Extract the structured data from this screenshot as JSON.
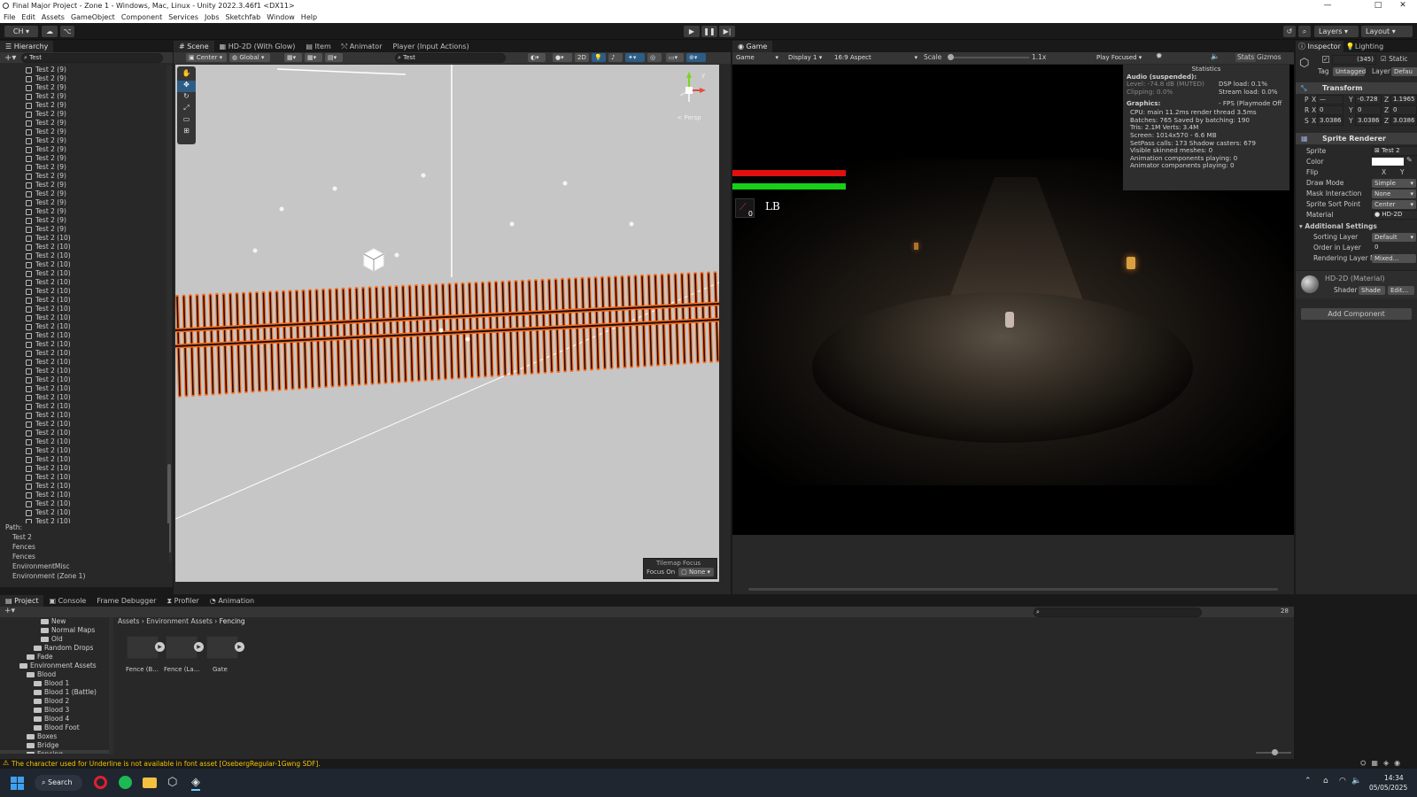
{
  "window": {
    "title": "Final Major Project - Zone 1 - Windows, Mac, Linux - Unity 2022.3.46f1 <DX11>"
  },
  "menu": [
    "File",
    "Edit",
    "Assets",
    "GameObject",
    "Component",
    "Services",
    "Jobs",
    "Sketchfab",
    "Window",
    "Help"
  ],
  "toolbar": {
    "account": "CH ▾",
    "layers": "Layers",
    "layout": "Layout"
  },
  "hierarchy": {
    "tab": "Hierarchy",
    "search": "Test",
    "items_a": "Test 2 (9)",
    "items_b": "Test 2 (10)",
    "count_a": 19,
    "count_b": 34,
    "path_label": "Path:",
    "path": [
      "Test 2",
      "Fences",
      "Fences",
      "EnvironmentMisc",
      "Environment (Zone 1)"
    ]
  },
  "scene": {
    "tabs": [
      "Scene",
      "HD-2D (With Glow)",
      "Item",
      "Animator",
      "Player (Input Actions)"
    ],
    "pivot": "Center",
    "space": "Global",
    "search": "Test",
    "mode2d": "2D",
    "gizmo_label": "< Persp",
    "tilemap_title": "Tilemap Focus",
    "focus_on": "Focus On",
    "focus_value": "None"
  },
  "game": {
    "tab": "Game",
    "view": "Game",
    "display": "Display 1",
    "aspect": "16:9 Aspect",
    "scale_label": "Scale",
    "scale_value": "1.1x",
    "play_focused": "Play Focused",
    "stats_btn": "Stats",
    "gizmos_btn": "Gizmos",
    "hud_button": "LB",
    "hud_item_count": "0",
    "health_fill": 1.0,
    "stamina_fill": 1.0
  },
  "statistics": {
    "title": "Statistics",
    "audio_title": "Audio (suspended):",
    "level": "Level: -74.8 dB (MUTED)",
    "clipping": "Clipping: 0.0%",
    "dsp": "DSP load: 0.1%",
    "stream": "Stream load: 0.0%",
    "graphics_title": "Graphics:",
    "fps": "- FPS (Playmode Off",
    "cpu": "CPU: main 11.2ms  render thread 3.5ms",
    "batches": "Batches: 765    Saved by batching: 190",
    "tris": "Tris: 2.1M          Verts: 3.4M",
    "screen": "Screen: 1014x570 - 6.6 MB",
    "setpass": "SetPass calls: 173       Shadow casters: 679",
    "skinned": "Visible skinned meshes: 0",
    "anim": "Animation components playing: 0",
    "animator": "Animator components playing: 0"
  },
  "inspector": {
    "tabs": [
      "Inspector",
      "Lighting"
    ],
    "object_name": "(345)",
    "static": "Static",
    "tag_label": "Tag",
    "tag": "Untagged",
    "layer_label": "Layer",
    "layer": "Defau",
    "transform": "Transform",
    "p_label": "P",
    "px": "X",
    "py": "Y",
    "pz": "Z",
    "pos_x": "—",
    "pos_y": "-0.728",
    "pos_z": "1.1965",
    "r_label": "R",
    "rot_x": "0",
    "rot_y": "0",
    "rot_z": "0",
    "s_label": "S",
    "scl_x": "3.0386",
    "scl_y": "3.0386",
    "scl_z": "3.0386",
    "sprite_renderer": "Sprite Renderer",
    "sprite_label": "Sprite",
    "sprite": "Test 2",
    "color_label": "Color",
    "flip_label": "Flip",
    "flip_x": "X",
    "flip_y": "Y",
    "draw_mode_label": "Draw Mode",
    "draw_mode": "Simple",
    "mask_label": "Mask Interaction",
    "mask": "None",
    "sort_point_label": "Sprite Sort Point",
    "sort_point": "Center",
    "material_label": "Material",
    "material": "HD-2D",
    "additional": "Additional Settings",
    "sorting_layer_label": "Sorting Layer",
    "sorting_layer": "Default",
    "order_label": "Order in Layer",
    "order": "0",
    "rendering_layer_label": "Rendering Layer M",
    "rendering_layer": "Mixed...",
    "material_name": "HD-2D (Material)",
    "shader_label": "Shader",
    "shader": "Shade",
    "edit": "Edit...",
    "add_component": "Add Component"
  },
  "project": {
    "tabs": [
      "Project",
      "Console",
      "Frame Debugger",
      "Profiler",
      "Animation"
    ],
    "tree": [
      {
        "label": "New",
        "indent": 46
      },
      {
        "label": "Normal Maps",
        "indent": 46
      },
      {
        "label": "Old",
        "indent": 46
      },
      {
        "label": "Random Drops",
        "indent": 38
      },
      {
        "label": "Fade",
        "indent": 30
      },
      {
        "label": "Environment Assets",
        "indent": 22
      },
      {
        "label": "Blood",
        "indent": 30
      },
      {
        "label": "Blood 1",
        "indent": 38
      },
      {
        "label": "Blood 1 (Battle)",
        "indent": 38
      },
      {
        "label": "Blood 2",
        "indent": 38
      },
      {
        "label": "Blood 3",
        "indent": 38
      },
      {
        "label": "Blood 4",
        "indent": 38
      },
      {
        "label": "Blood Foot",
        "indent": 38
      },
      {
        "label": "Boxes",
        "indent": 30
      },
      {
        "label": "Bridge",
        "indent": 30
      },
      {
        "label": "Fencing",
        "indent": 30
      }
    ],
    "breadcrumb": [
      "Assets",
      "Environment Assets",
      "Fencing"
    ],
    "assets": [
      "Fence (B...",
      "Fence (La...",
      "Gate"
    ],
    "count": "28"
  },
  "status": {
    "message": "The character used for Underline is not available in font asset [OsebergRegular-1Gwng SDF]."
  },
  "taskbar": {
    "search": "Search",
    "time": "14:34",
    "date": "05/05/2025"
  },
  "colors": {
    "accent": "#2c5d87",
    "health": "#e01010",
    "stamina": "#18d018",
    "fence": "#ff6a1a",
    "warn": "#f4c400"
  }
}
